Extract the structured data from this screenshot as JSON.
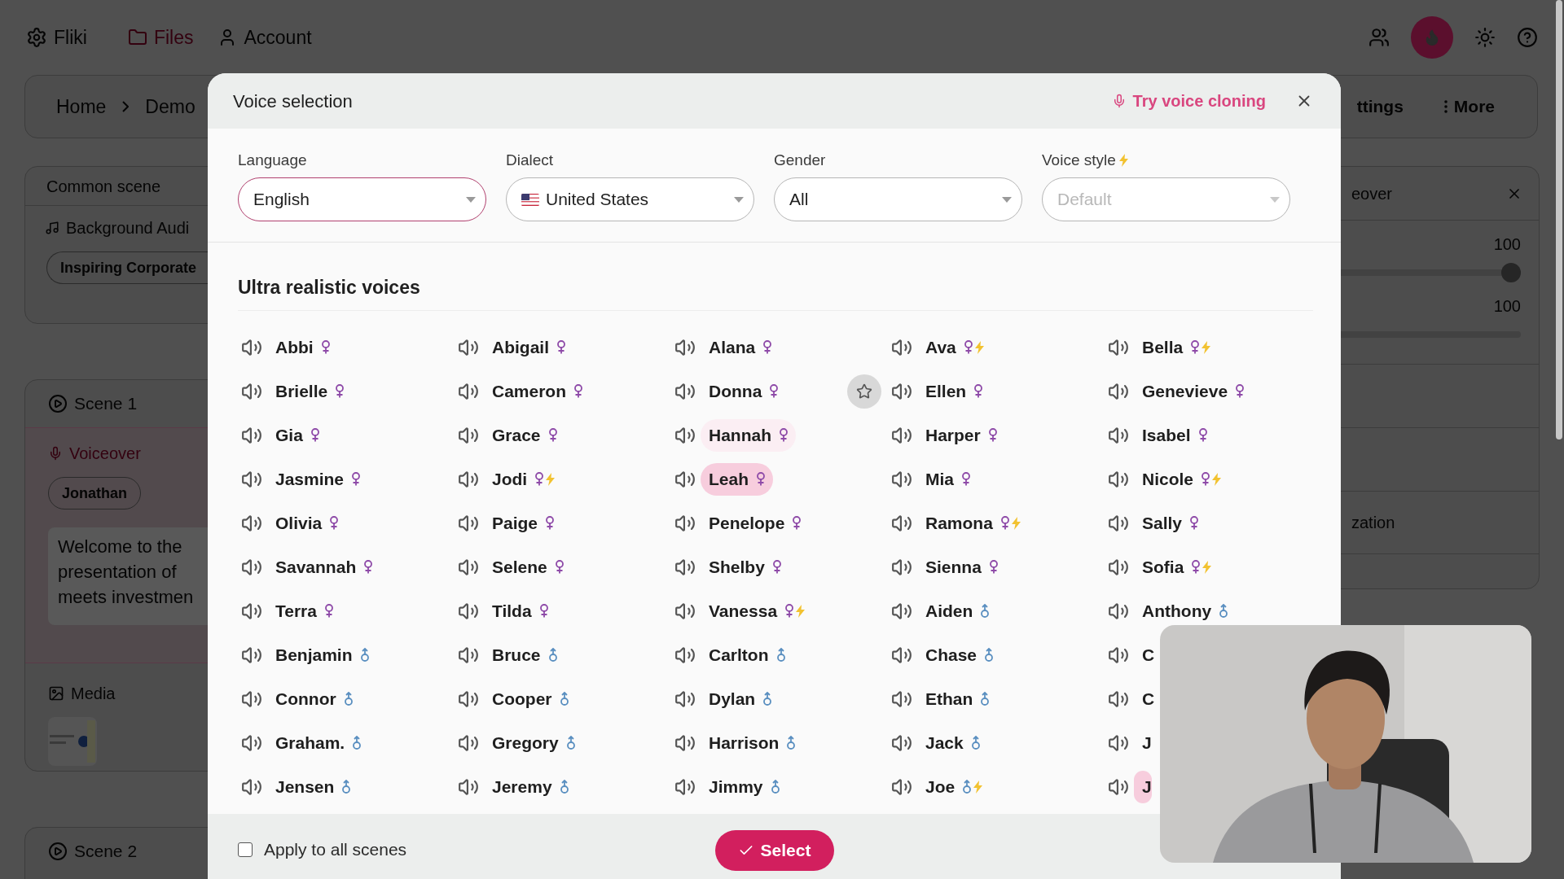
{
  "app_bar": {
    "logo": "Fliki",
    "nav": [
      {
        "label": "Files",
        "selected": true
      },
      {
        "label": "Account",
        "selected": false
      }
    ]
  },
  "breadcrumb": [
    "Home",
    "Demo"
  ],
  "header_actions": {
    "settings": "ttings",
    "more": "More"
  },
  "common_scene": {
    "title": "Common scene",
    "audio_label": "Background Audi",
    "audio_chip": "Inspiring Corporate"
  },
  "scenes": [
    {
      "title": "Scene 1",
      "voiceover_label": "Voiceover",
      "voice_chip": "Jonathan",
      "script_lines": [
        "Welcome to the",
        "presentation of",
        "meets investmen"
      ],
      "media_label": "Media"
    },
    {
      "title": "Scene 2"
    }
  ],
  "side_panel": {
    "title": "eover",
    "sliders": [
      {
        "reading": "100",
        "level": 1
      },
      {
        "reading": "100"
      }
    ],
    "rows": [
      "zation"
    ]
  },
  "modal": {
    "title": "Voice selection",
    "clone_link": "Try voice cloning",
    "filters": [
      {
        "label": "Language",
        "value": "English",
        "focused": true,
        "disabled": false,
        "premium": false,
        "flag": false
      },
      {
        "label": "Dialect",
        "value": "United States",
        "focused": false,
        "disabled": false,
        "premium": false,
        "flag": true
      },
      {
        "label": "Gender",
        "value": "All",
        "focused": false,
        "disabled": false,
        "premium": false,
        "flag": false
      },
      {
        "label": "Voice style",
        "value": "Default",
        "focused": false,
        "disabled": true,
        "premium": true,
        "flag": false
      }
    ],
    "section_title": "Ultra realistic voices",
    "voices": [
      {
        "name": "Abbi",
        "kind": "female",
        "premium": false,
        "selected": false,
        "hovered": false,
        "star": false
      },
      {
        "name": "Abigail",
        "kind": "female",
        "premium": false,
        "selected": false,
        "hovered": false,
        "star": false
      },
      {
        "name": "Alana",
        "kind": "female",
        "premium": false,
        "selected": false,
        "hovered": false,
        "star": false
      },
      {
        "name": "Ava",
        "kind": "female",
        "premium": true,
        "selected": false,
        "hovered": false,
        "star": false
      },
      {
        "name": "Bella",
        "kind": "female",
        "premium": true,
        "selected": false,
        "hovered": false,
        "star": false
      },
      {
        "name": "Brielle",
        "kind": "female",
        "premium": false,
        "selected": false,
        "hovered": false,
        "star": false
      },
      {
        "name": "Cameron",
        "kind": "female",
        "premium": false,
        "selected": false,
        "hovered": false,
        "star": false
      },
      {
        "name": "Donna",
        "kind": "female",
        "premium": false,
        "selected": false,
        "hovered": false,
        "star": true
      },
      {
        "name": "Ellen",
        "kind": "female",
        "premium": false,
        "selected": false,
        "hovered": false,
        "star": false
      },
      {
        "name": "Genevieve",
        "kind": "female",
        "premium": false,
        "selected": false,
        "hovered": false,
        "star": false
      },
      {
        "name": "Gia",
        "kind": "female",
        "premium": false,
        "selected": false,
        "hovered": false,
        "star": false
      },
      {
        "name": "Grace",
        "kind": "female",
        "premium": false,
        "selected": false,
        "hovered": false,
        "star": false
      },
      {
        "name": "Hannah",
        "kind": "female",
        "premium": false,
        "selected": false,
        "hovered": true,
        "star": false
      },
      {
        "name": "Harper",
        "kind": "female",
        "premium": false,
        "selected": false,
        "hovered": false,
        "star": false
      },
      {
        "name": "Isabel",
        "kind": "female",
        "premium": false,
        "selected": false,
        "hovered": false,
        "star": false
      },
      {
        "name": "Jasmine",
        "kind": "female",
        "premium": false,
        "selected": false,
        "hovered": false,
        "star": false
      },
      {
        "name": "Jodi",
        "kind": "female",
        "premium": true,
        "selected": false,
        "hovered": false,
        "star": false
      },
      {
        "name": "Leah",
        "kind": "female",
        "premium": false,
        "selected": true,
        "hovered": false,
        "star": false
      },
      {
        "name": "Mia",
        "kind": "female",
        "premium": false,
        "selected": false,
        "hovered": false,
        "star": false
      },
      {
        "name": "Nicole",
        "kind": "female",
        "premium": true,
        "selected": false,
        "hovered": false,
        "star": false
      },
      {
        "name": "Olivia",
        "kind": "female",
        "premium": false,
        "selected": false,
        "hovered": false,
        "star": false
      },
      {
        "name": "Paige",
        "kind": "female",
        "premium": false,
        "selected": false,
        "hovered": false,
        "star": false
      },
      {
        "name": "Penelope",
        "kind": "female",
        "premium": false,
        "selected": false,
        "hovered": false,
        "star": false
      },
      {
        "name": "Ramona",
        "kind": "female",
        "premium": true,
        "selected": false,
        "hovered": false,
        "star": false
      },
      {
        "name": "Sally",
        "kind": "female",
        "premium": false,
        "selected": false,
        "hovered": false,
        "star": false
      },
      {
        "name": "Savannah",
        "kind": "female",
        "premium": false,
        "selected": false,
        "hovered": false,
        "star": false
      },
      {
        "name": "Selene",
        "kind": "female",
        "premium": false,
        "selected": false,
        "hovered": false,
        "star": false
      },
      {
        "name": "Shelby",
        "kind": "female",
        "premium": false,
        "selected": false,
        "hovered": false,
        "star": false
      },
      {
        "name": "Sienna",
        "kind": "female",
        "premium": false,
        "selected": false,
        "hovered": false,
        "star": false
      },
      {
        "name": "Sofia",
        "kind": "female",
        "premium": true,
        "selected": false,
        "hovered": false,
        "star": false
      },
      {
        "name": "Terra",
        "kind": "female",
        "premium": false,
        "selected": false,
        "hovered": false,
        "star": false
      },
      {
        "name": "Tilda",
        "kind": "female",
        "premium": false,
        "selected": false,
        "hovered": false,
        "star": false
      },
      {
        "name": "Vanessa",
        "kind": "female",
        "premium": true,
        "selected": false,
        "hovered": false,
        "star": false
      },
      {
        "name": "Aiden",
        "kind": "male",
        "premium": false,
        "selected": false,
        "hovered": false,
        "star": false
      },
      {
        "name": "Anthony",
        "kind": "male",
        "premium": false,
        "selected": false,
        "hovered": false,
        "star": false
      },
      {
        "name": "Benjamin",
        "kind": "male",
        "premium": false,
        "selected": false,
        "hovered": false,
        "star": false
      },
      {
        "name": "Bruce",
        "kind": "male",
        "premium": false,
        "selected": false,
        "hovered": false,
        "star": false
      },
      {
        "name": "Carlton",
        "kind": "male",
        "premium": false,
        "selected": false,
        "hovered": false,
        "star": false
      },
      {
        "name": "Chase",
        "kind": "male",
        "premium": false,
        "selected": false,
        "hovered": false,
        "star": false
      },
      {
        "name": "C",
        "kind": "cut",
        "selected": false,
        "hovered": false
      },
      {
        "name": "Connor",
        "kind": "male",
        "premium": false,
        "selected": false,
        "hovered": false,
        "star": false
      },
      {
        "name": "Cooper",
        "kind": "male",
        "premium": false,
        "selected": false,
        "hovered": false,
        "star": false
      },
      {
        "name": "Dylan",
        "kind": "male",
        "premium": false,
        "selected": false,
        "hovered": false,
        "star": false
      },
      {
        "name": "Ethan",
        "kind": "male",
        "premium": false,
        "selected": false,
        "hovered": false,
        "star": false
      },
      {
        "name": "C",
        "kind": "cut",
        "selected": false,
        "hovered": false
      },
      {
        "name": "Graham.",
        "kind": "male",
        "premium": false,
        "selected": false,
        "hovered": false,
        "star": false
      },
      {
        "name": "Gregory",
        "kind": "male",
        "premium": false,
        "selected": false,
        "hovered": false,
        "star": false
      },
      {
        "name": "Harrison",
        "kind": "male",
        "premium": false,
        "selected": false,
        "hovered": false,
        "star": false
      },
      {
        "name": "Jack",
        "kind": "male",
        "premium": false,
        "selected": false,
        "hovered": false,
        "star": false
      },
      {
        "name": "J",
        "kind": "cut",
        "selected": false,
        "hovered": false
      },
      {
        "name": "Jensen",
        "kind": "male",
        "premium": false,
        "selected": false,
        "hovered": false,
        "star": false
      },
      {
        "name": "Jeremy",
        "kind": "male",
        "premium": false,
        "selected": false,
        "hovered": false,
        "star": false
      },
      {
        "name": "Jimmy",
        "kind": "male",
        "premium": false,
        "selected": false,
        "hovered": false,
        "star": false
      },
      {
        "name": "Joe",
        "kind": "male",
        "premium": true,
        "selected": false,
        "hovered": false,
        "star": false
      },
      {
        "name": "J",
        "kind": "cut",
        "selected": true,
        "hovered": false
      }
    ],
    "apply_all": {
      "label": "Apply to all scenes",
      "checked": false
    },
    "select_button": "Select"
  },
  "webcam": {
    "kind": "picture"
  }
}
